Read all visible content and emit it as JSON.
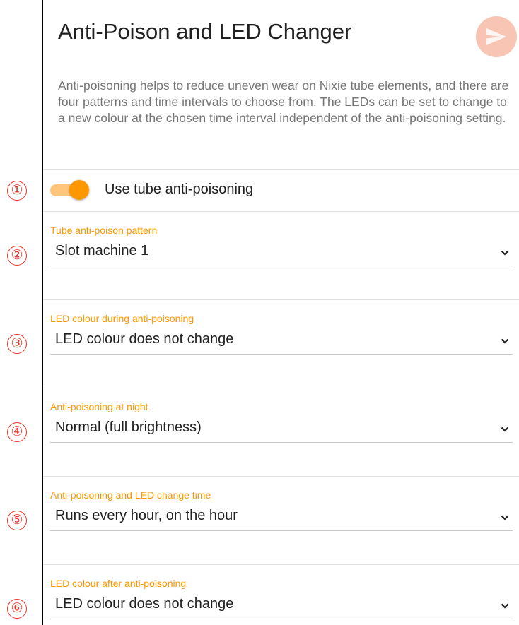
{
  "header": {
    "title": "Anti-Poison and LED Changer",
    "send_icon": "send-icon",
    "description": "Anti-poisoning helps to reduce uneven wear on Nixie tube elements, and there are four patterns and time intervals to choose from. The LEDs can be set to change to a new colour at the chosen time interval independent of the anti-poisoning setting."
  },
  "toggle": {
    "label": "Use tube anti-poisoning",
    "checked": true
  },
  "fields": [
    {
      "label": "Tube anti-poison pattern",
      "value": "Slot machine 1"
    },
    {
      "label": "LED colour during anti-poisoning",
      "value": "LED colour does not change"
    },
    {
      "label": "Anti-poisoning at night",
      "value": "Normal (full brightness)"
    },
    {
      "label": "Anti-poisoning and LED change time",
      "value": "Runs every hour, on the hour"
    },
    {
      "label": "LED colour after anti-poisoning",
      "value": "LED colour does not change"
    }
  ],
  "markers": [
    "①",
    "②",
    "③",
    "④",
    "⑤",
    "⑥"
  ],
  "colors": {
    "accent": "#ff9800",
    "accent_light": "#ffc57a",
    "send_button": "#f8c4b3",
    "marker": "#e8342a",
    "text": "#212121",
    "muted": "#757575"
  }
}
